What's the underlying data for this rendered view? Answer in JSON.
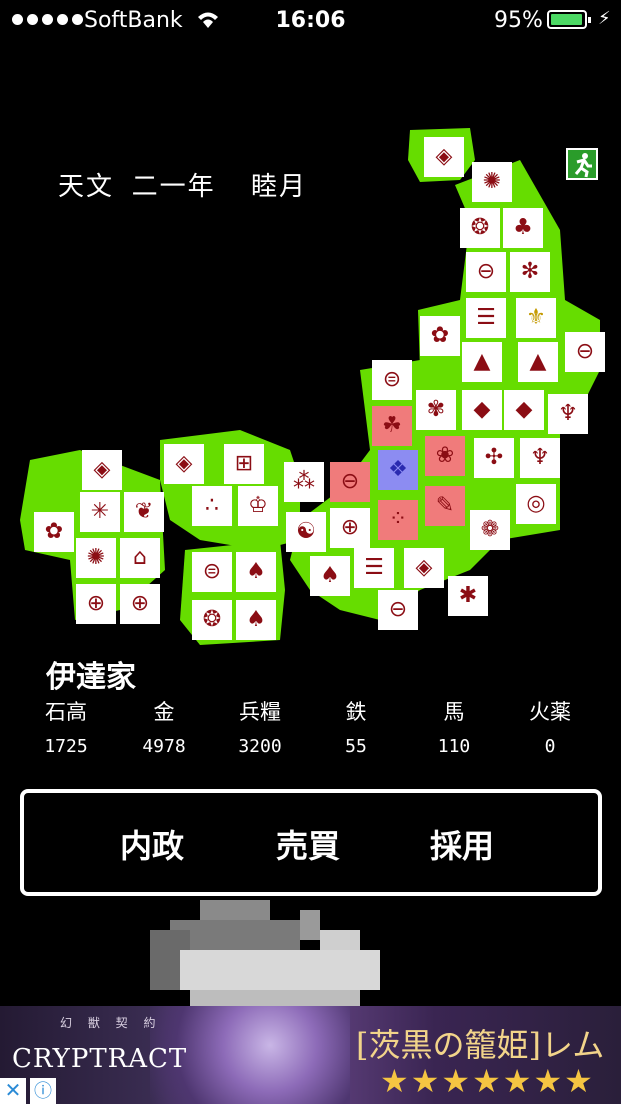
{
  "status_bar": {
    "carrier": "SoftBank",
    "time": "16:06",
    "battery_percent": "95%",
    "battery_level": 0.95
  },
  "game": {
    "date": "天文 二一年  睦月",
    "clan_name": "伊達家",
    "stats": {
      "labels": [
        "石高",
        "金",
        "兵糧",
        "鉄",
        "馬",
        "火薬"
      ],
      "values": [
        "1725",
        "4978",
        "3200",
        "55",
        "110",
        "0"
      ]
    },
    "menu": {
      "domestic": "内政",
      "trade": "売買",
      "recruit": "採用"
    }
  },
  "ad": {
    "subtitle": "幻 獣 契 約",
    "logo": "CRYPTRACT",
    "title": "[茨黒の籠姫]レム",
    "stars": "★★★★★★★"
  },
  "colors": {
    "map_land": "#66dd00",
    "crest_red": "#8b0d14",
    "highlight_red": "#f07b7b",
    "highlight_blue": "#8c8cf2"
  }
}
